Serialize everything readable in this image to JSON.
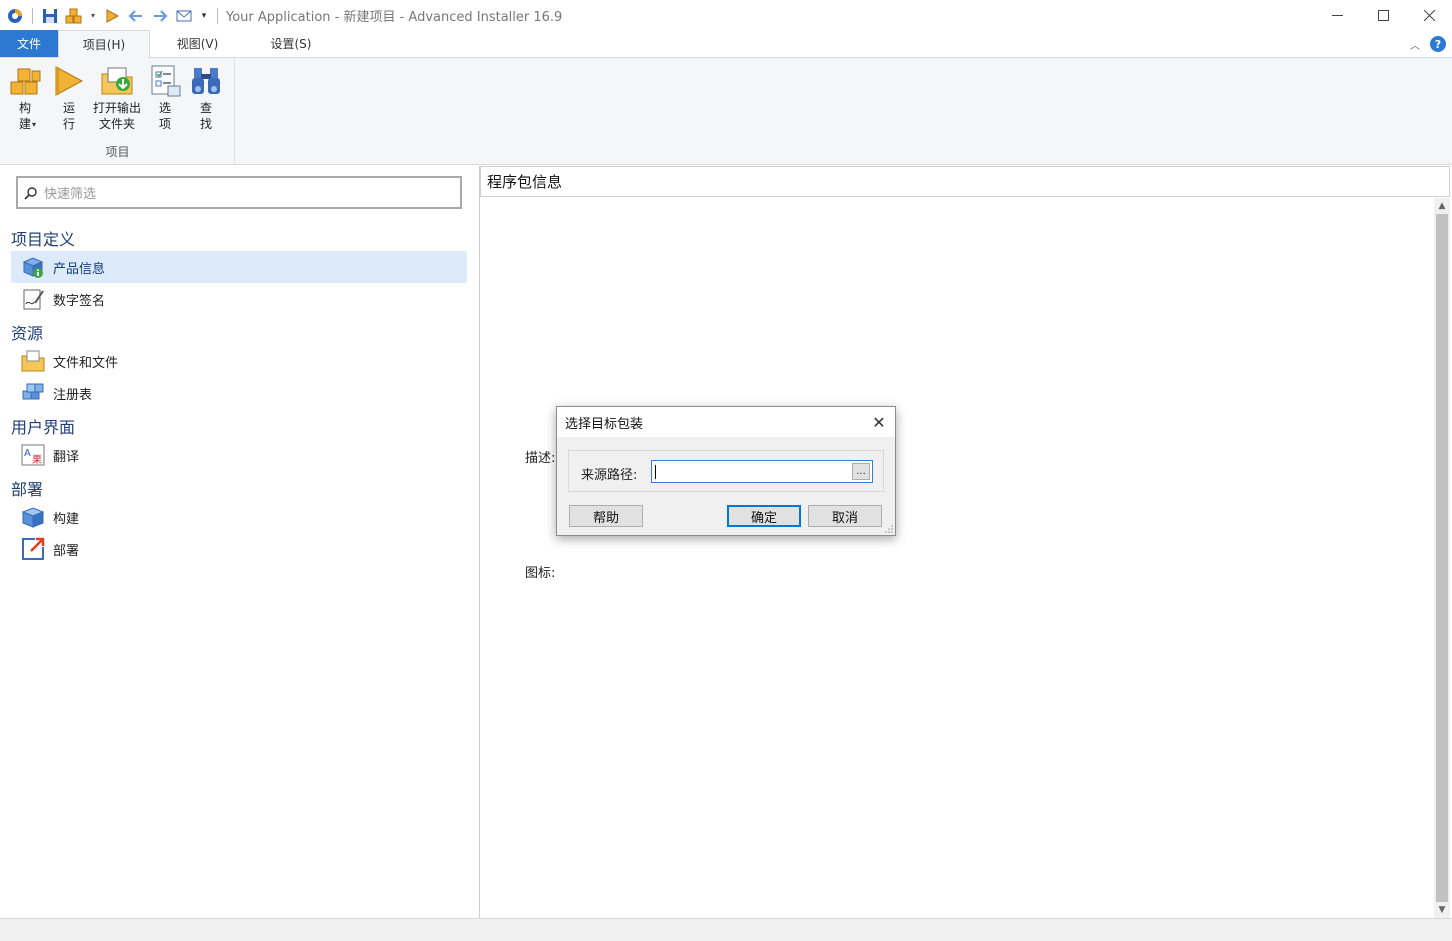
{
  "window": {
    "title": "Your Application - 新建项目 - Advanced Installer 16.9"
  },
  "tabs": {
    "file": "文件",
    "project": "项目(H)",
    "view": "视图(V)",
    "settings": "设置(S)"
  },
  "ribbon": {
    "group_label": "项目",
    "build_label": "构\n建",
    "run_label": "运\n行",
    "open_output_label": "打开输出\n文件夹",
    "options_label": "选\n项",
    "find_label": "查\n找"
  },
  "sidebar": {
    "search_placeholder": "快速筛选",
    "categories": [
      {
        "label": "项目定义"
      },
      {
        "label": "资源"
      },
      {
        "label": "用户界面"
      },
      {
        "label": "部署"
      }
    ],
    "items": [
      {
        "label": "产品信息",
        "icon": "product-info-icon"
      },
      {
        "label": "数字签名",
        "icon": "digital-signature-icon"
      },
      {
        "label": "文件和文件",
        "icon": "folder-icon"
      },
      {
        "label": "注册表",
        "icon": "registry-icon"
      },
      {
        "label": "翻译",
        "icon": "translate-icon"
      },
      {
        "label": "构建",
        "icon": "build-icon"
      },
      {
        "label": "部署",
        "icon": "deploy-icon"
      }
    ]
  },
  "main": {
    "header": "程序包信息",
    "description_label": "描述:",
    "icon_label": "图标:"
  },
  "dialog": {
    "title": "选择目标包装",
    "source_label": "来源路径:",
    "source_value": "",
    "browse_label": "...",
    "help_label": "帮助",
    "ok_label": "确定",
    "cancel_label": "取消"
  },
  "colors": {
    "accent": "#2b79d0",
    "selection": "#ddeaf9",
    "category_text": "#1f3f75"
  }
}
